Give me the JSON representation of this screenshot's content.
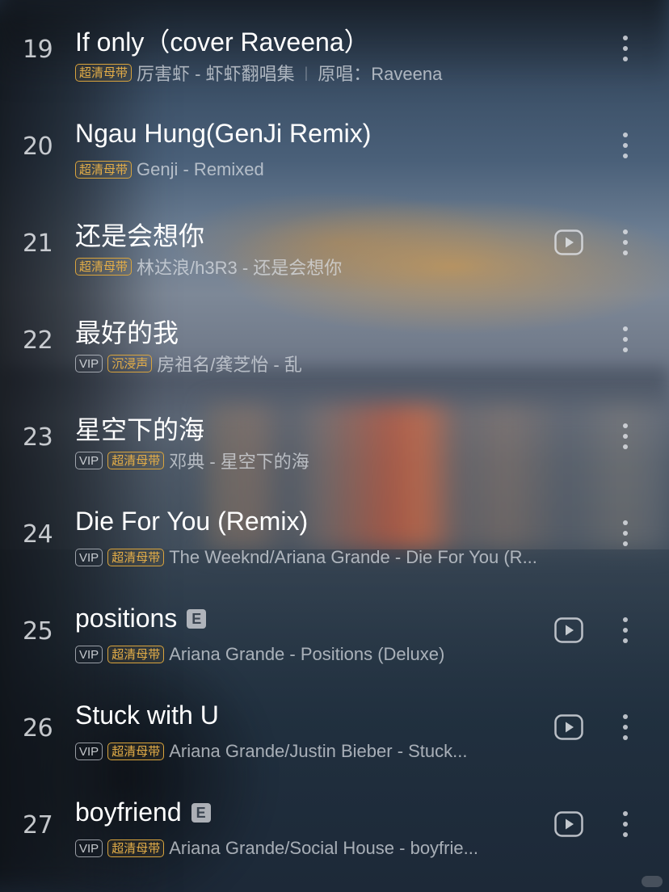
{
  "songs": [
    {
      "index": "19",
      "title": "If only（cover Raveena）",
      "tags": [
        "超清母带"
      ],
      "subtitle": "厉害虾 - 虾虾翻唱集",
      "original_label": "原唱：Raveena",
      "explicit": false,
      "has_video": false
    },
    {
      "index": "20",
      "title": "Ngau Hung(GenJi Remix)",
      "tags": [
        "超清母带"
      ],
      "subtitle": "Genji - Remixed",
      "explicit": false,
      "has_video": false
    },
    {
      "index": "21",
      "title": "还是会想你",
      "tags": [
        "超清母带"
      ],
      "subtitle": "林达浪/h3R3 - 还是会想你",
      "explicit": false,
      "has_video": true
    },
    {
      "index": "22",
      "title": "最好的我",
      "tags": [
        "VIP",
        "沉浸声"
      ],
      "subtitle": "房祖名/龚芝怡 - 乱",
      "explicit": false,
      "has_video": false
    },
    {
      "index": "23",
      "title": "星空下的海",
      "tags": [
        "VIP",
        "超清母带"
      ],
      "subtitle": "邓典 - 星空下的海",
      "explicit": false,
      "has_video": false
    },
    {
      "index": "24",
      "title": "Die For You (Remix)",
      "tags": [
        "VIP",
        "超清母带"
      ],
      "subtitle": "The Weeknd/Ariana Grande - Die For You (R...",
      "explicit": false,
      "has_video": false
    },
    {
      "index": "25",
      "title": "positions",
      "tags": [
        "VIP",
        "超清母带"
      ],
      "subtitle": "Ariana Grande - Positions (Deluxe)",
      "explicit": true,
      "has_video": true
    },
    {
      "index": "26",
      "title": "Stuck with U",
      "tags": [
        "VIP",
        "超清母带"
      ],
      "subtitle": "Ariana Grande/Justin Bieber - Stuck...",
      "explicit": false,
      "has_video": true
    },
    {
      "index": "27",
      "title": "boyfriend",
      "tags": [
        "VIP",
        "超清母带"
      ],
      "subtitle": "Ariana Grande/Social House - boyfrie...",
      "explicit": true,
      "has_video": true
    }
  ],
  "explicit_badge": "E",
  "icons": {
    "video": "play-video-icon",
    "more": "more-vertical-icon"
  },
  "colors": {
    "quality_tag": "#d9a43d",
    "text_primary": "#ffffff"
  }
}
